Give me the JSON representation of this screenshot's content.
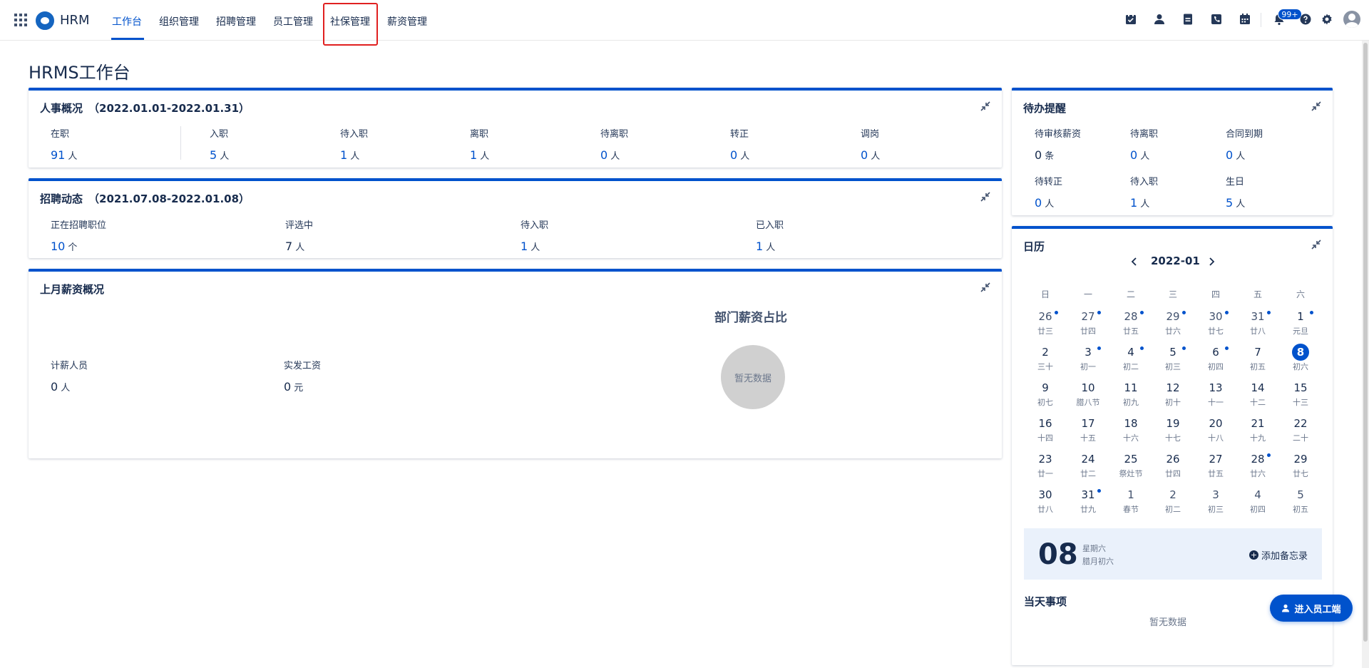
{
  "topbar": {
    "brand": "HRM",
    "nav": [
      "工作台",
      "组织管理",
      "招聘管理",
      "员工管理",
      "社保管理",
      "薪资管理"
    ],
    "active_index": 0,
    "highlighted_index": 4,
    "notification_badge": "99+",
    "tool_icons": [
      "checklist-icon",
      "person-icon",
      "document-icon",
      "phone-icon",
      "calendar-icon",
      "bell-icon",
      "help-icon",
      "gear-icon",
      "avatar"
    ]
  },
  "page": {
    "title": "HRMS工作台"
  },
  "hr_overview": {
    "title": "人事概况",
    "range": "（2022.01.01-2022.01.31）",
    "stats": [
      {
        "label": "在职",
        "value": "91",
        "unit": "人"
      },
      {
        "label": "入职",
        "value": "5",
        "unit": "人"
      },
      {
        "label": "待入职",
        "value": "1",
        "unit": "人"
      },
      {
        "label": "离职",
        "value": "1",
        "unit": "人"
      },
      {
        "label": "待离职",
        "value": "0",
        "unit": "人"
      },
      {
        "label": "转正",
        "value": "0",
        "unit": "人"
      },
      {
        "label": "调岗",
        "value": "0",
        "unit": "人"
      }
    ]
  },
  "recruit": {
    "title": "招聘动态",
    "range": "（2021.07.08-2022.01.08）",
    "stats": [
      {
        "label": "正在招聘职位",
        "value": "10",
        "unit": "个"
      },
      {
        "label": "评选中",
        "value": "7",
        "unit": "人"
      },
      {
        "label": "待入职",
        "value": "1",
        "unit": "人"
      },
      {
        "label": "已入职",
        "value": "1",
        "unit": "人"
      }
    ]
  },
  "salary": {
    "title": "上月薪资概况",
    "stats": [
      {
        "label": "计薪人员",
        "value": "0",
        "unit": "人"
      },
      {
        "label": "实发工资",
        "value": "0",
        "unit": "元"
      }
    ],
    "chart_title": "部门薪资占比",
    "chart_empty": "暂无数据"
  },
  "todo": {
    "title": "待办提醒",
    "items": [
      {
        "label": "待审核薪资",
        "value": "0",
        "unit": "条",
        "dark": true
      },
      {
        "label": "待离职",
        "value": "0",
        "unit": "人",
        "dark": false
      },
      {
        "label": "合同到期",
        "value": "0",
        "unit": "人",
        "dark": false
      },
      {
        "label": "待转正",
        "value": "0",
        "unit": "人",
        "dark": false
      },
      {
        "label": "待入职",
        "value": "1",
        "unit": "人",
        "dark": false
      },
      {
        "label": "生日",
        "value": "5",
        "unit": "人",
        "dark": false
      }
    ]
  },
  "calendar": {
    "title": "日历",
    "month": "2022-01",
    "weekdays": [
      "日",
      "一",
      "二",
      "三",
      "四",
      "五",
      "六"
    ],
    "days": [
      {
        "n": "26",
        "l": "廿三",
        "dot": true,
        "dim": true
      },
      {
        "n": "27",
        "l": "廿四",
        "dot": true,
        "dim": true
      },
      {
        "n": "28",
        "l": "廿五",
        "dot": true,
        "dim": true
      },
      {
        "n": "29",
        "l": "廿六",
        "dot": true,
        "dim": true
      },
      {
        "n": "30",
        "l": "廿七",
        "dot": true,
        "dim": true
      },
      {
        "n": "31",
        "l": "廿八",
        "dot": true,
        "dim": true
      },
      {
        "n": "1",
        "l": "元旦",
        "dot": true
      },
      {
        "n": "2",
        "l": "三十"
      },
      {
        "n": "3",
        "l": "初一",
        "dot": true
      },
      {
        "n": "4",
        "l": "初二",
        "dot": true
      },
      {
        "n": "5",
        "l": "初三",
        "dot": true
      },
      {
        "n": "6",
        "l": "初四",
        "dot": true
      },
      {
        "n": "7",
        "l": "初五"
      },
      {
        "n": "8",
        "l": "初六",
        "today": true
      },
      {
        "n": "9",
        "l": "初七"
      },
      {
        "n": "10",
        "l": "腊八节"
      },
      {
        "n": "11",
        "l": "初九"
      },
      {
        "n": "12",
        "l": "初十"
      },
      {
        "n": "13",
        "l": "十一"
      },
      {
        "n": "14",
        "l": "十二"
      },
      {
        "n": "15",
        "l": "十三"
      },
      {
        "n": "16",
        "l": "十四"
      },
      {
        "n": "17",
        "l": "十五"
      },
      {
        "n": "18",
        "l": "十六"
      },
      {
        "n": "19",
        "l": "十七"
      },
      {
        "n": "20",
        "l": "十八"
      },
      {
        "n": "21",
        "l": "十九"
      },
      {
        "n": "22",
        "l": "二十"
      },
      {
        "n": "23",
        "l": "廿一"
      },
      {
        "n": "24",
        "l": "廿二"
      },
      {
        "n": "25",
        "l": "祭灶节"
      },
      {
        "n": "26",
        "l": "廿四"
      },
      {
        "n": "27",
        "l": "廿五"
      },
      {
        "n": "28",
        "l": "廿六",
        "dot": true
      },
      {
        "n": "29",
        "l": "廿七"
      },
      {
        "n": "30",
        "l": "廿八"
      },
      {
        "n": "31",
        "l": "廿九",
        "dot": true
      },
      {
        "n": "1",
        "l": "春节",
        "dim": true
      },
      {
        "n": "2",
        "l": "初二",
        "dim": true
      },
      {
        "n": "3",
        "l": "初三",
        "dim": true
      },
      {
        "n": "4",
        "l": "初四",
        "dim": true
      },
      {
        "n": "5",
        "l": "初五",
        "dim": true
      }
    ],
    "memo": {
      "day": "08",
      "weekday": "星期六",
      "lunar": "腊月初六",
      "add_label": "添加备忘录"
    },
    "today_title": "当天事项",
    "today_empty": "暂无数据"
  },
  "employee_button": "进入员工端",
  "colors": {
    "accent": "#0052cc",
    "highlight": "#e02020"
  }
}
